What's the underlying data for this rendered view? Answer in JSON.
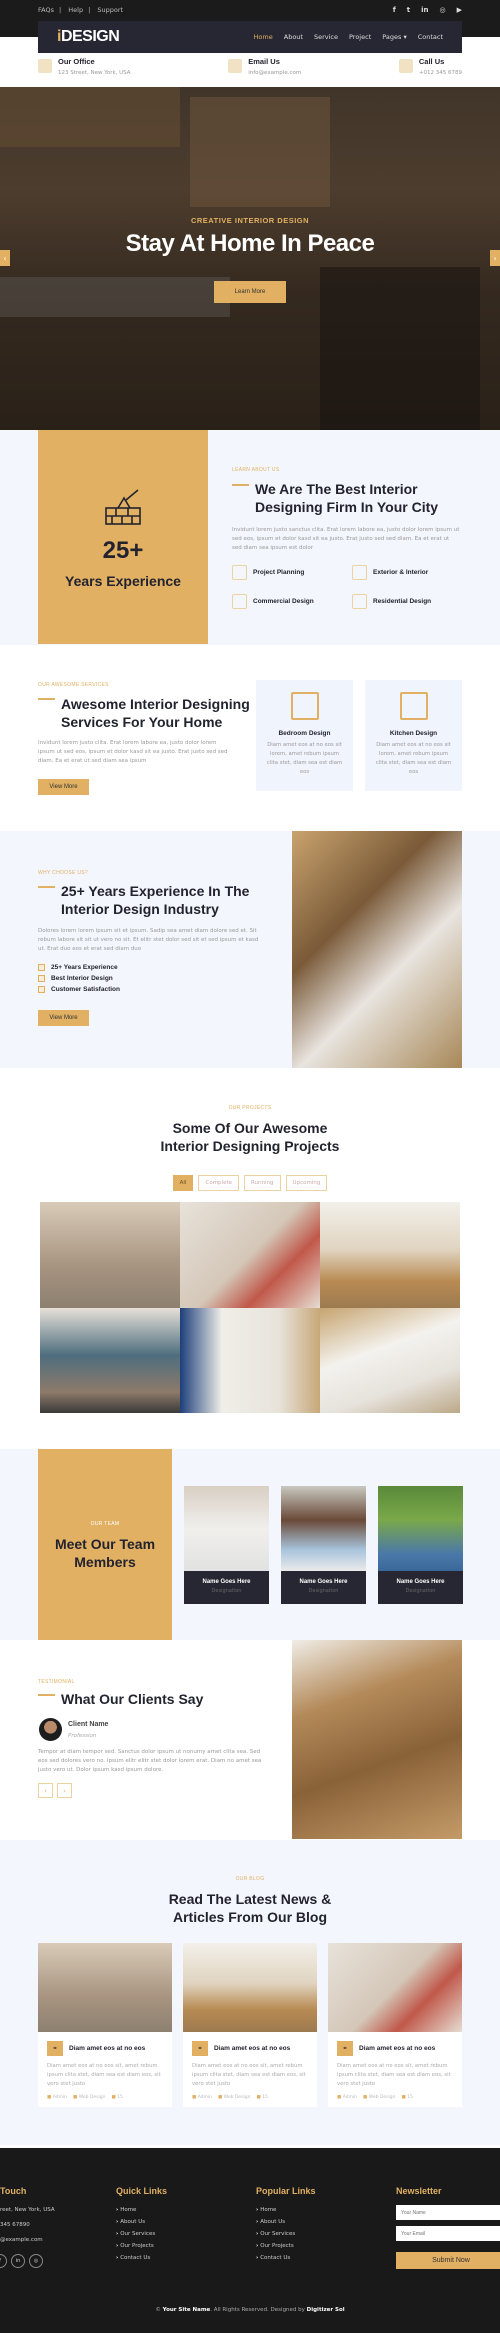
{
  "topbar": {
    "links": [
      "FAQs",
      "Help",
      "Support"
    ],
    "separator": "|",
    "social_icons": [
      "facebook-icon",
      "twitter-icon",
      "linkedin-icon",
      "instagram-icon",
      "youtube-icon"
    ],
    "social_glyphs": [
      "f",
      "t",
      "in",
      "◎",
      "▶"
    ]
  },
  "navbar": {
    "logo_accent": "i",
    "logo_rest": "DESIGN",
    "items": [
      "Home",
      "About",
      "Service",
      "Project",
      "Pages ▾",
      "Contact"
    ],
    "active": "Home"
  },
  "contact_strip": [
    {
      "title": "Our Office",
      "value": "123 Street, New York, USA"
    },
    {
      "title": "Email Us",
      "value": "info@example.com"
    },
    {
      "title": "Call Us",
      "value": "+012 345 6789"
    }
  ],
  "hero": {
    "subtitle": "CREATIVE INTERIOR DESIGN",
    "title": "Stay At Home In Peace",
    "button": "Learn More",
    "prev": "‹",
    "next": "›"
  },
  "about": {
    "experience_number": "25+",
    "experience_label": "Years Experience",
    "label": "Learn About Us",
    "title": "We Are The Best Interior Designing Firm In Your City",
    "text": "Invidunt lorem justo sanctus clita. Erat lorem labore ea, justo dolor lorem ipsum ut sed eos, ipsum et dolor kasd sit ea justo. Erat justo sed sed diam. Ea et erat ut sed diam sea ipsum est dolor",
    "features": [
      "Project Planning",
      "Exterior & Interior",
      "Commercial Design",
      "Residential Design"
    ]
  },
  "services": {
    "label": "Our Awesome Services",
    "title": "Awesome Interior Designing Services For Your Home",
    "text": "Invidunt lorem justo clita. Erat lorem labore ea, justo dolor lorem ipsum ut sed eos, ipsum et dolor kasd sit ea justo. Erat justo sed sed diam. Ea et erat ut sed diam sea ipsum",
    "button": "View More",
    "cards": [
      {
        "title": "Bedroom Design",
        "text": "Diam amet eos at no eos sit lorem, amet rebum ipsum clita stet, diam sea est diam eos"
      },
      {
        "title": "Kitchen Design",
        "text": "Diam amet eos at no eos sit lorem, amet rebum ipsum clita stet, diam sea est diam eos"
      }
    ]
  },
  "why": {
    "label": "Why Choose Us?",
    "title": "25+ Years Experience In The Interior Design Industry",
    "text": "Dolores lorem lorem ipsum sit et ipsum. Sadip sea amet diam dolore sed et. Sit rebum labore sit sit ut vero no sit. Et elitr stet dolor sed sit et sed ipsum et kasd ut. Erat duo eos et erat sed diam duo",
    "checks": [
      "25+ Years Experience",
      "Best Interior Design",
      "Customer Satisfaction"
    ],
    "button": "View More"
  },
  "projects": {
    "label": "Our Projects",
    "title": "Some Of Our Awesome Interior Designing Projects",
    "filters": [
      "All",
      "Complete",
      "Running",
      "Upcoming"
    ],
    "active_filter": "All",
    "images": [
      "living-room-tv",
      "living-room-red-chair",
      "sunny-living-room",
      "blue-living-room",
      "white-tv-room",
      "attic-living-room"
    ]
  },
  "team": {
    "label": "Our Team",
    "title": "Meet Our Team Members",
    "members": [
      {
        "name": "Name Goes Here",
        "designation": "Designation"
      },
      {
        "name": "Name Goes Here",
        "designation": "Designation"
      },
      {
        "name": "Name Goes Here",
        "designation": "Designation"
      }
    ]
  },
  "testimonial": {
    "label": "Testimonial",
    "title": "What Our Clients Say",
    "client_name": "Client Name",
    "profession": "Profession",
    "text": "Tempor at diam tempor sed. Sanctus dolor ipsum ut nonumy amet clita sea. Sed eos sed dolores vero no. Ipsum elitr elitr stet dolor lorem erat. Diam no amet sea justo vero ut. Dolor ipsum kasd ipsum dolore.",
    "prev": "‹",
    "next": "›"
  },
  "blog": {
    "label": "Our Blog",
    "title": "Read The Latest News & Articles From Our Blog",
    "posts": [
      {
        "title": "Diam amet eos at no eos",
        "text": "Diam amet eos at no eos sit, amet rebum ipsum clita stet, diam sea est diam eos, sit vero stet justo",
        "author": "Admin",
        "category": "Web Design",
        "comments": "15"
      },
      {
        "title": "Diam amet eos at no eos",
        "text": "Diam amet eos at no eos sit, amet rebum ipsum clita stet, diam sea est diam eos, sit vero stet justo",
        "author": "Admin",
        "category": "Web Design",
        "comments": "15"
      },
      {
        "title": "Diam amet eos at no eos",
        "text": "Diam amet eos at no eos sit, amet rebum ipsum clita stet, diam sea est diam eos, sit vero stet justo",
        "author": "Admin",
        "category": "Web Design",
        "comments": "15"
      }
    ]
  },
  "footer": {
    "touch_title": "Touch",
    "address": "reet, New York, USA",
    "phone": "345 67890",
    "email": "@example.com",
    "quick_title": "Quick Links",
    "quick_links": [
      "Home",
      "About Us",
      "Our Services",
      "Our Projects",
      "Contact Us"
    ],
    "popular_title": "Popular Links",
    "popular_links": [
      "Home",
      "About Us",
      "Our Services",
      "Our Projects",
      "Contact Us"
    ],
    "newsletter_title": "Newsletter",
    "name_placeholder": "Your Name",
    "email_placeholder": "Your Email",
    "submit": "Submit Now",
    "copy_prefix": "©",
    "site_name": "Your Site Name",
    "copy_mid": ". All Rights Reserved. Designed by",
    "designer": "Digitizer Sol"
  },
  "colors": {
    "accent": "#e1b062",
    "dark": "#23232f",
    "navbar": "#272733",
    "footer": "#191919",
    "light_bg": "#f4f6fd"
  }
}
